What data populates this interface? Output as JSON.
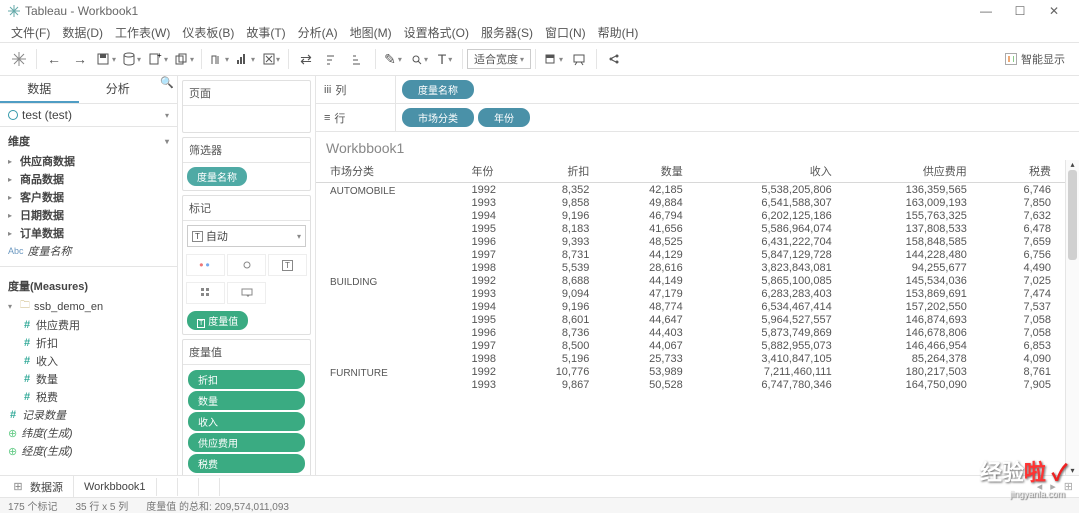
{
  "titlebar": {
    "title": "Tableau - Workbook1"
  },
  "menu": [
    "文件(F)",
    "数据(D)",
    "工作表(W)",
    "仪表板(B)",
    "故事(T)",
    "分析(A)",
    "地图(M)",
    "设置格式(O)",
    "服务器(S)",
    "窗口(N)",
    "帮助(H)"
  ],
  "toolbar": {
    "fit_label": "适合宽度"
  },
  "smart": "智能显示",
  "left": {
    "tab_data": "数据",
    "tab_analytics": "分析",
    "datasource": "test (test)",
    "dimensions_title": "维度",
    "dims": [
      "供应商数据",
      "商品数据",
      "客户数据",
      "日期数据",
      "订单数据"
    ],
    "dim_field": "度量名称",
    "measures_title": "度量(Measures)",
    "folder": "ssb_demo_en",
    "meas": [
      "供应费用",
      "折扣",
      "收入",
      "数量",
      "税费",
      "记录数量"
    ],
    "calc1": "纬度(生成)",
    "calc2": "经度(生成)"
  },
  "middle": {
    "pages": "页面",
    "filters": "筛选器",
    "filter_field": "度量名称",
    "marks": "标记",
    "auto": "自动",
    "mark_label": "度量值",
    "values_title": "度量值",
    "values": [
      "折扣",
      "数量",
      "收入",
      "供应费用",
      "税费"
    ]
  },
  "shelves": {
    "cols_label": "列",
    "cols": [
      "度量名称"
    ],
    "rows_label": "行",
    "rows": [
      "市场分类",
      "年份"
    ]
  },
  "viz": {
    "title": "Workbbook1",
    "cat_header": "市场分类",
    "year_header": "年份",
    "cols": [
      "折扣",
      "数量",
      "收入",
      "供应费用",
      "税费"
    ],
    "rows": [
      {
        "cat": "AUTOMOBILE",
        "yrs": [
          [
            "1992",
            "8,352",
            "42,185",
            "5,538,205,806",
            "136,359,565",
            "6,746"
          ],
          [
            "1993",
            "9,858",
            "49,884",
            "6,541,588,307",
            "163,009,193",
            "7,850"
          ],
          [
            "1994",
            "9,196",
            "46,794",
            "6,202,125,186",
            "155,763,325",
            "7,632"
          ],
          [
            "1995",
            "8,183",
            "41,656",
            "5,586,964,074",
            "137,808,533",
            "6,478"
          ],
          [
            "1996",
            "9,393",
            "48,525",
            "6,431,222,704",
            "158,848,585",
            "7,659"
          ],
          [
            "1997",
            "8,731",
            "44,129",
            "5,847,129,728",
            "144,228,480",
            "6,756"
          ],
          [
            "1998",
            "5,539",
            "28,616",
            "3,823,843,081",
            "94,255,677",
            "4,490"
          ]
        ]
      },
      {
        "cat": "BUILDING",
        "yrs": [
          [
            "1992",
            "8,688",
            "44,149",
            "5,865,100,085",
            "145,534,036",
            "7,025"
          ],
          [
            "1993",
            "9,094",
            "47,179",
            "6,283,283,403",
            "153,869,691",
            "7,474"
          ],
          [
            "1994",
            "9,196",
            "48,774",
            "6,534,467,414",
            "157,202,550",
            "7,537"
          ],
          [
            "1995",
            "8,601",
            "44,647",
            "5,964,527,557",
            "146,874,693",
            "7,058"
          ],
          [
            "1996",
            "8,736",
            "44,403",
            "5,873,749,869",
            "146,678,806",
            "7,058"
          ],
          [
            "1997",
            "8,500",
            "44,067",
            "5,882,955,073",
            "146,466,954",
            "6,853"
          ],
          [
            "1998",
            "5,196",
            "25,733",
            "3,410,847,105",
            "85,264,378",
            "4,090"
          ]
        ]
      },
      {
        "cat": "FURNITURE",
        "yrs": [
          [
            "1992",
            "10,776",
            "53,989",
            "7,211,460,111",
            "180,217,503",
            "8,761"
          ],
          [
            "1993",
            "9,867",
            "50,528",
            "6,747,780,346",
            "164,750,090",
            "7,905"
          ]
        ]
      }
    ]
  },
  "sheets": {
    "datasource": "数据源",
    "sheet1": "Workbbook1"
  },
  "status": {
    "marks": "175 个标记",
    "rows": "35 行 x 5 列",
    "sum": "度量值 的总和: 209,574,011,093"
  },
  "watermark": {
    "brand_a": "经验",
    "brand_b": "啦",
    "sub": "jingyanla.com"
  }
}
